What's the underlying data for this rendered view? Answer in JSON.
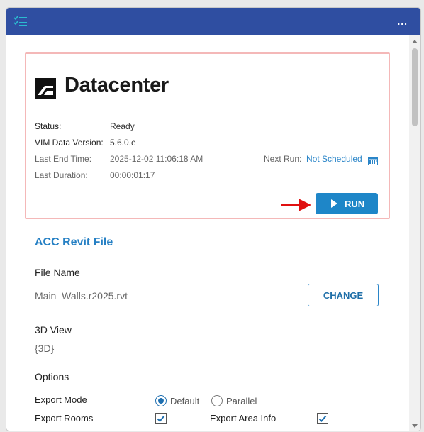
{
  "titlebar": {
    "more_label": "...",
    "menu_icon": "list-check-icon"
  },
  "header": {
    "app_title": "Datacenter",
    "logo_icon": "autodesk-logo-icon"
  },
  "status": {
    "status_label": "Status:",
    "status_value": "Ready",
    "vim_label": "VIM Data Version:",
    "vim_value": "5.6.0.e",
    "last_end_label": "Last End Time:",
    "last_end_value": "2025-12-02 11:06:18 AM",
    "next_run_label": "Next Run:",
    "next_run_value": "Not Scheduled",
    "last_duration_label": "Last Duration:",
    "last_duration_value": "00:00:01:17"
  },
  "run_button": {
    "label": "RUN"
  },
  "acc": {
    "section_title": "ACC Revit File",
    "file_name_label": "File Name",
    "file_name_value": "Main_Walls.r2025.rvt",
    "change_label": "CHANGE",
    "view_label": "3D View",
    "view_value": "{3D}",
    "options_label": "Options",
    "export_mode_label": "Export Mode",
    "mode_default": "Default",
    "mode_parallel": "Parallel",
    "mode_selected": "Default",
    "export_rooms_label": "Export Rooms",
    "export_rooms_checked": true,
    "export_area_label": "Export Area Info",
    "export_area_checked": true
  },
  "colors": {
    "titlebar": "#2f4ea1",
    "accent": "#1e86c8",
    "highlight_border": "#f4b8b8",
    "arrow": "#e01010"
  }
}
